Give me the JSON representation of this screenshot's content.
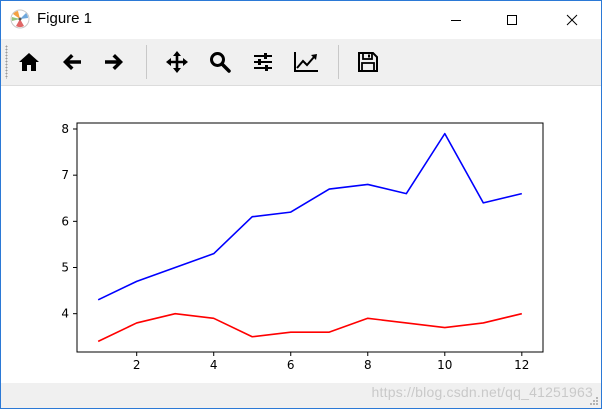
{
  "window": {
    "title": "Figure 1"
  },
  "toolbar": {
    "tools": [
      {
        "name": "home-icon",
        "label": "home"
      },
      {
        "name": "back-icon",
        "label": "back"
      },
      {
        "name": "forward-icon",
        "label": "forward"
      },
      {
        "name": "pan-icon",
        "label": "pan"
      },
      {
        "name": "zoom-icon",
        "label": "zoom"
      },
      {
        "name": "subplots-icon",
        "label": "configure subplots"
      },
      {
        "name": "edit-axis-icon",
        "label": "edit axis"
      },
      {
        "name": "save-icon",
        "label": "save"
      }
    ]
  },
  "status": {
    "watermark": "https://blog.csdn.net/qq_41251963"
  },
  "colors": {
    "accent_border": "#2b79d6",
    "series_blue": "#0000ff",
    "series_red": "#ff0000"
  },
  "chart_data": {
    "type": "line",
    "x": [
      1,
      2,
      3,
      4,
      5,
      6,
      7,
      8,
      9,
      10,
      11,
      12
    ],
    "series": [
      {
        "color": "#0000ff",
        "values": [
          4.3,
          4.7,
          5.0,
          5.3,
          6.1,
          6.2,
          6.7,
          6.8,
          6.6,
          7.9,
          6.4,
          6.6
        ]
      },
      {
        "color": "#ff0000",
        "values": [
          3.4,
          3.8,
          4.0,
          3.9,
          3.5,
          3.6,
          3.6,
          3.9,
          3.8,
          3.7,
          3.8,
          4.0
        ]
      }
    ],
    "xlim": [
      0.45,
      12.55
    ],
    "ylim": [
      3.17,
      8.13
    ],
    "xticks": [
      2,
      4,
      6,
      8,
      10,
      12
    ],
    "yticks": [
      4,
      5,
      6,
      7,
      8
    ],
    "grid": false,
    "title": "",
    "xlabel": "",
    "ylabel": ""
  }
}
